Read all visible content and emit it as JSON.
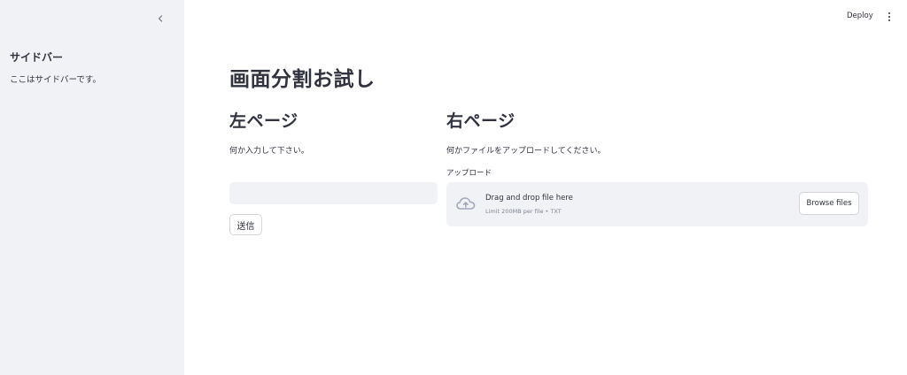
{
  "sidebar": {
    "title": "サイドバー",
    "text": "ここはサイドバーです。"
  },
  "header": {
    "deploy_label": "Deploy"
  },
  "main": {
    "title": "画面分割お試し",
    "left": {
      "heading": "左ページ",
      "text": "何か入力して下さい。",
      "input_value": "",
      "submit_label": "送信"
    },
    "right": {
      "heading": "右ページ",
      "text": "何かファイルをアップロードしてください。",
      "uploader": {
        "label": "アップロード",
        "drop_text": "Drag and drop file here",
        "limit_text": "Limit 200MB per file • TXT",
        "browse_label": "Browse files"
      }
    }
  },
  "colors": {
    "sidebar_bg": "#f0f2f6",
    "text": "#31333f",
    "muted_text": "#808495",
    "icon": "#a3a8b8"
  },
  "icons": [
    "chevron-left-icon",
    "kebab-menu-icon",
    "cloud-upload-icon"
  ]
}
